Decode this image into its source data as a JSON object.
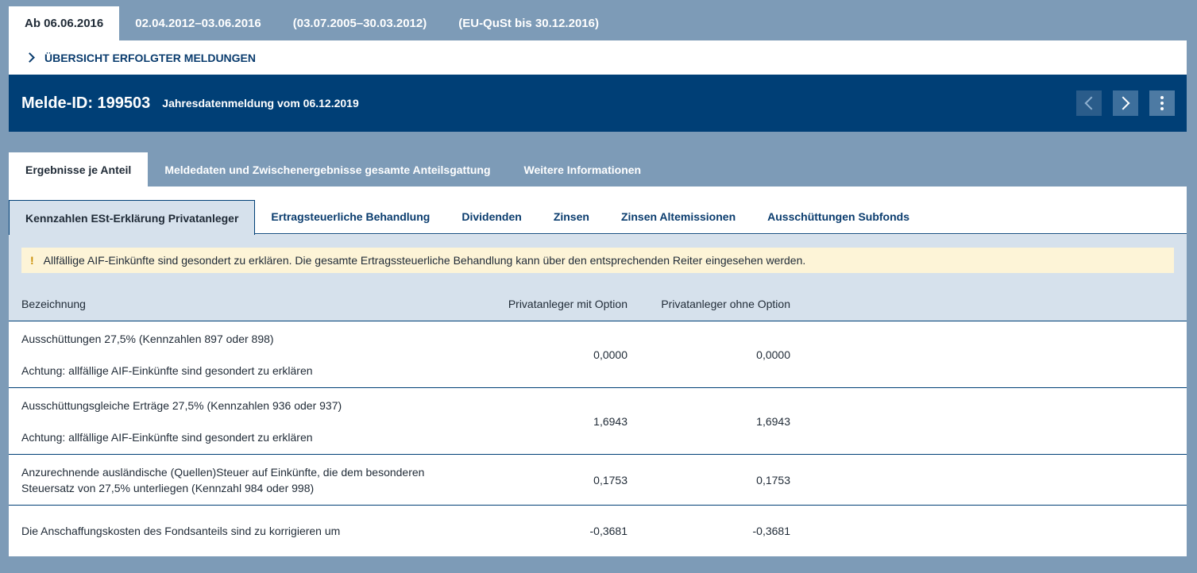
{
  "top_tabs": [
    "Ab 06.06.2016",
    "02.04.2012–03.06.2016",
    "(03.07.2005–30.03.2012)",
    "(EU-QuSt bis 30.12.2016)"
  ],
  "overview_label": "ÜBERSICHT ERFOLGTER MELDUNGEN",
  "header": {
    "melde_id": "Melde-ID: 199503",
    "subtitle": "Jahresdatenmeldung vom 06.12.2019"
  },
  "main_tabs": [
    "Ergebnisse je Anteil",
    "Meldedaten und Zwischenergebnisse gesamte Anteilsgattung",
    "Weitere Informationen"
  ],
  "sub_tabs": [
    "Kennzahlen ESt-Erklärung Privatanleger",
    "Ertragsteuerliche Behandlung",
    "Dividenden",
    "Zinsen",
    "Zinsen Altemissionen",
    "Ausschüttungen Subfonds"
  ],
  "notice": {
    "icon": "!",
    "text": "Allfällige AIF-Einkünfte sind gesondert zu erklären. Die gesamte Ertragssteuerliche Behandlung kann über den entsprechenden Reiter eingesehen werden."
  },
  "table": {
    "headers": [
      "Bezeichnung",
      "Privatanleger mit Option",
      "Privatanleger ohne Option"
    ],
    "rows": [
      {
        "line1": "Ausschüttungen 27,5% (Kennzahlen 897 oder 898)",
        "line2": "Achtung: allfällige AIF-Einkünfte sind gesondert zu erklären",
        "mit": "0,0000",
        "ohne": "0,0000"
      },
      {
        "line1": "Ausschüttungsgleiche Erträge 27,5% (Kennzahlen 936 oder 937)",
        "line2": "Achtung: allfällige AIF-Einkünfte sind gesondert zu erklären",
        "mit": "1,6943",
        "ohne": "1,6943"
      },
      {
        "line1": "Anzurechnende ausländische (Quellen)Steuer auf Einkünfte, die dem besonderen Steuersatz von 27,5% unterliegen (Kennzahl 984 oder 998)",
        "mit": "0,1753",
        "ohne": "0,1753"
      },
      {
        "line1": "Die Anschaffungskosten des Fondsanteils sind zu korrigieren um",
        "mit": "-0,3681",
        "ohne": "-0,3681"
      }
    ]
  },
  "colors": {
    "header_bg": "#003f76",
    "page_bg": "#7d9bb7",
    "notice_bg": "#fdf4d7"
  }
}
